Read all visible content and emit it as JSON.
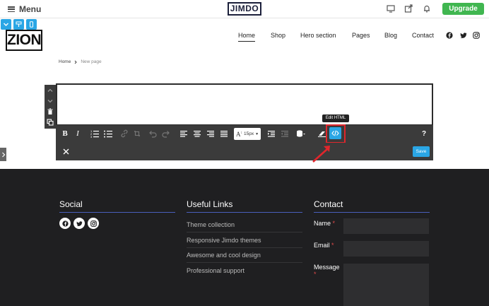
{
  "admin_bar": {
    "menu_label": "Menu",
    "brand": "JIMDO",
    "upgrade_label": "Upgrade",
    "icons": [
      "monitor-icon",
      "share-icon",
      "bell-icon"
    ]
  },
  "site": {
    "logo_text": "ZION",
    "nav": [
      "Home",
      "Shop",
      "Hero section",
      "Pages",
      "Blog",
      "Contact"
    ],
    "active_nav": "Home",
    "social_icons": [
      "facebook-icon",
      "twitter-icon",
      "instagram-icon"
    ]
  },
  "breadcrumb": {
    "home": "Home",
    "current": "New page"
  },
  "editor": {
    "font_size": "15px",
    "tooltip": "Edit HTML",
    "help_label": "?",
    "save_label": "Save"
  },
  "footer": {
    "social_heading": "Social",
    "links_heading": "Useful Links",
    "contact_heading": "Contact",
    "links": [
      "Theme collection",
      "Responsive Jimdo themes",
      "Awesome and cool design",
      "Professional support"
    ],
    "form": {
      "name_label": "Name",
      "email_label": "Email",
      "message_label": "Message",
      "required_mark": "*"
    }
  },
  "colors": {
    "accent": "#2aa6e5",
    "upgrade": "#40b650",
    "highlight": "#e0262c",
    "footer_bg": "#1f1f21",
    "rule": "#4a5ebd"
  }
}
